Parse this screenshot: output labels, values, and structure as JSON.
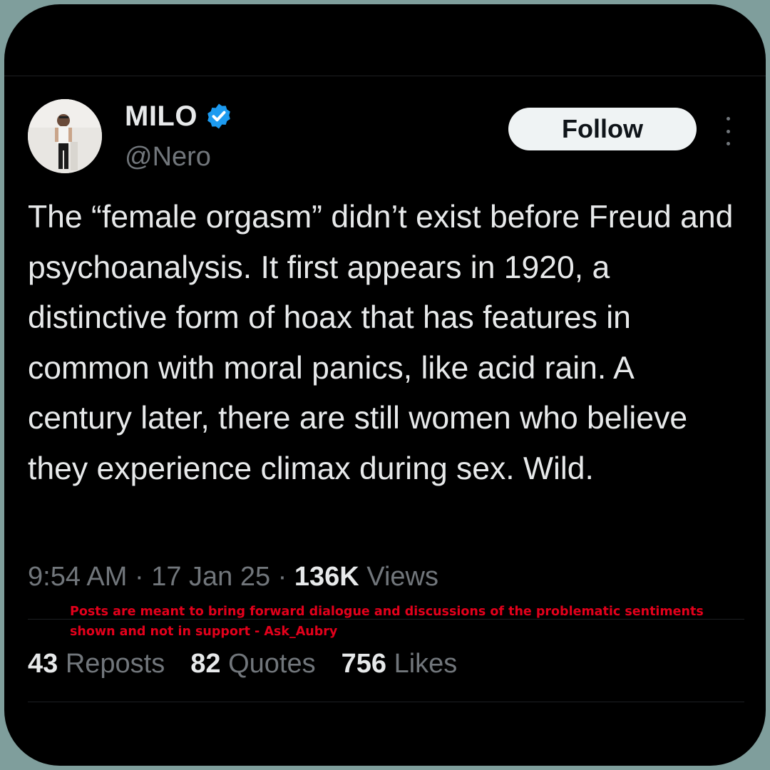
{
  "user": {
    "display_name": "MILO",
    "handle": "@Nero",
    "verified": true
  },
  "follow_label": "Follow",
  "tweet_text": "The “female orgasm” didn’t exist before Freud and psychoanalysis. It first appears in 1920, a distinctive form of hoax that has features in common with moral panics, like acid rain. A century later, there are still women who believe they experience climax during sex. Wild.",
  "meta": {
    "time": "9:54 AM",
    "separator": " · ",
    "date": "17 Jan 25",
    "views_count": "136K",
    "views_label": " Views"
  },
  "disclaimer": "Posts are meant to bring forward dialogue and discussions of the problematic sentiments shown and not in support - Ask_Aubry",
  "stats": {
    "reposts_count": "43",
    "reposts_label": " Reposts",
    "quotes_count": "82",
    "quotes_label": " Quotes",
    "likes_count": "756",
    "likes_label": " Likes"
  },
  "colors": {
    "background": "#000000",
    "outer": "#7f9e9c",
    "text_primary": "#e7e9ea",
    "text_secondary": "#71767b",
    "verified_badge": "#1d9bf0",
    "disclaimer": "#e3001b"
  },
  "icons": [
    "verified-badge-icon",
    "more-options-icon"
  ]
}
